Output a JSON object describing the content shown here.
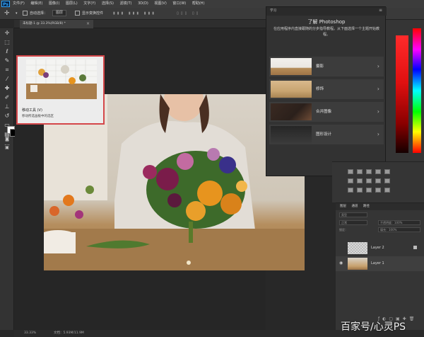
{
  "menubar": {
    "logo": "Ps",
    "items": [
      "文件(F)",
      "编辑(E)",
      "图像(I)",
      "图层(L)",
      "文字(Y)",
      "选择(S)",
      "滤镜(T)",
      "3D(D)",
      "视图(V)",
      "窗口(W)",
      "帮助(H)"
    ]
  },
  "options": {
    "auto_select_label": "自动选择：",
    "auto_select_value": "图层",
    "show_transform_label": "显示变换控件"
  },
  "document": {
    "tab_title": "未标题-1 @ 33.3%(RGB/8) *"
  },
  "tooltip": {
    "title": "移动工具 (V)",
    "description": "移动所选画板中的选区"
  },
  "learn": {
    "tab_label": "学习",
    "title": "了解 Photoshop",
    "description": "在应用程序内直接跟随的分步指导教程。从下面选择一个主题开始教程。",
    "topics": [
      {
        "label": "摄影"
      },
      {
        "label": "修饰"
      },
      {
        "label": "合并图像"
      },
      {
        "label": "图形设计"
      }
    ]
  },
  "layers": {
    "tabs": [
      "图层",
      "通道",
      "路径"
    ],
    "kind_placeholder": "类型",
    "blend_mode": "正常",
    "opacity_label": "不透明度：100%",
    "lock_label": "锁定：",
    "fill_label": "填充：100%",
    "items": [
      {
        "name": "Layer 2",
        "locked": true
      },
      {
        "name": "Layer 1",
        "locked": false
      }
    ]
  },
  "status": {
    "zoom": "33.33%",
    "doc_info": "文档：5.93M/11.9M"
  },
  "watermark": "百家号/心灵PS",
  "colors": {
    "tooltip_border": "#d4474a",
    "photoshop_blue": "#31a8ff",
    "panel_bg": "#323232",
    "canvas_bg": "#262626"
  }
}
